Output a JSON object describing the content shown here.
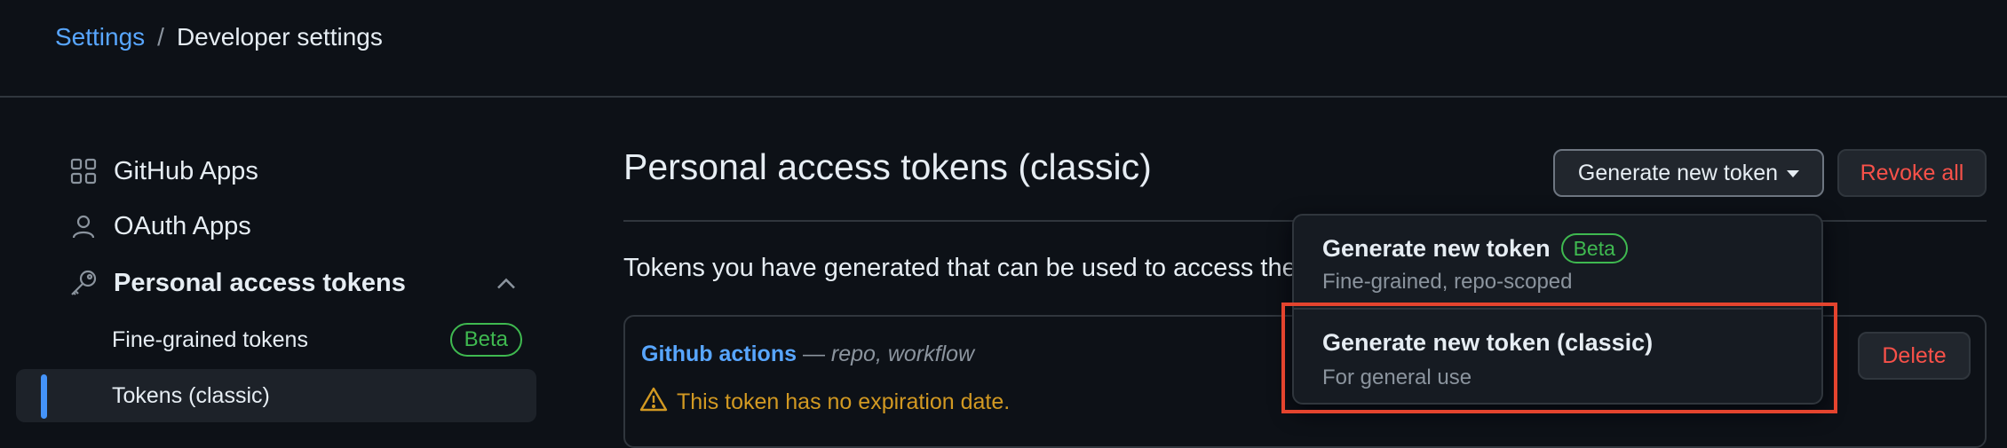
{
  "breadcrumb": {
    "parent": "Settings",
    "separator": "/",
    "current": "Developer settings"
  },
  "sidebar": {
    "items": [
      {
        "label": "GitHub Apps",
        "icon": "apps-grid-icon"
      },
      {
        "label": "OAuth Apps",
        "icon": "person-icon"
      },
      {
        "label": "Personal access tokens",
        "icon": "key-icon",
        "expanded": true
      }
    ],
    "subitems": [
      {
        "label": "Fine-grained tokens",
        "badge": "Beta"
      },
      {
        "label": "Tokens (classic)",
        "active": true
      }
    ]
  },
  "main": {
    "title": "Personal access tokens (classic)",
    "generate_button": "Generate new token",
    "revoke_button": "Revoke all",
    "description": "Tokens you have generated that can be used to access the",
    "token": {
      "name": "Github actions",
      "scopes_separator": " — ",
      "scopes": "repo, workflow",
      "warning": "This token has no expiration date.",
      "delete_button": "Delete"
    }
  },
  "dropdown": {
    "items": [
      {
        "title": "Generate new token",
        "badge": "Beta",
        "subtitle": "Fine-grained, repo-scoped"
      },
      {
        "title": "Generate new token (classic)",
        "subtitle": "For general use",
        "highlighted": true
      }
    ]
  },
  "colors": {
    "background": "#0d1117",
    "link": "#58a6ff",
    "danger": "#f85149",
    "success": "#3fb950",
    "warning": "#d29922",
    "highlight": "#e4442e"
  }
}
